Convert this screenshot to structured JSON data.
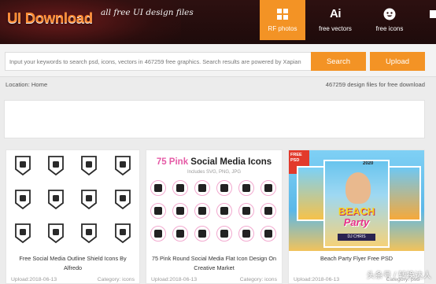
{
  "header": {
    "logo_text": "UI Download",
    "logo_tagline": "all free UI design files",
    "tabs": [
      {
        "label": "RF photos",
        "icon": "grid-icon",
        "active": true
      },
      {
        "label": "free vectors",
        "icon": "ai-icon",
        "icon_text": "Ai"
      },
      {
        "label": "free icons",
        "icon": "smiley-icon"
      }
    ],
    "accent_color": "#f39325",
    "header_color": "#2a0f0f"
  },
  "search": {
    "placeholder": "Input your keywords to search psd, icons, vectors in 467259 free graphics. Search results are powered by Xapian",
    "search_label": "Search",
    "upload_label": "Upload"
  },
  "location": {
    "text": "Location: Home",
    "count_text": "467259 design files for free download"
  },
  "cards": [
    {
      "title": "Free Social Media Outline Shield Icons By Alfredo",
      "upload": "Upload:2018-06-13",
      "category": "Category: icons",
      "icon_names": [
        "twitter-icon",
        "skype-icon",
        "feed-icon",
        "reddit-icon",
        "snapchat-icon",
        "instagram-icon",
        "google-plus-icon",
        "youtube-icon",
        "blogger-icon",
        "dribbble-icon",
        "behance-icon",
        "github-icon"
      ]
    },
    {
      "title": "75 Pink Round Social Media Flat Icon Design On Creative Market",
      "thumb_title_pink": "75 Pink",
      "thumb_title_dark": " Social Media Icons",
      "thumb_subtitle": "Includes SVG, PNG, JPG",
      "upload": "Upload:2018-06-13",
      "category": "Category: icons",
      "icon_names": [
        "facebook-icon",
        "feed-icon",
        "skype-icon",
        "youtube-icon",
        "snapchat-icon",
        "phone-icon",
        "twitter-icon",
        "linkedin-icon",
        "vimeo-icon",
        "flickr-icon",
        "vine-icon",
        "messenger-icon",
        "youtube-text-icon",
        "dribbble-icon",
        "stumbleupon-icon",
        "tumblr-icon",
        "instagram-icon",
        "google-plus-icon"
      ]
    },
    {
      "title": "Beach Party Flyer Free PSD",
      "thumb_badge": "FREE PSD",
      "thumb_word1": "BEACH",
      "thumb_word2": "Party",
      "thumb_year": "2020",
      "thumb_dj": "DJ CHRIS",
      "upload": "Upload:2018-06-13",
      "category": "Category: psd"
    }
  ],
  "watermark": "头条号 / 转换达人"
}
